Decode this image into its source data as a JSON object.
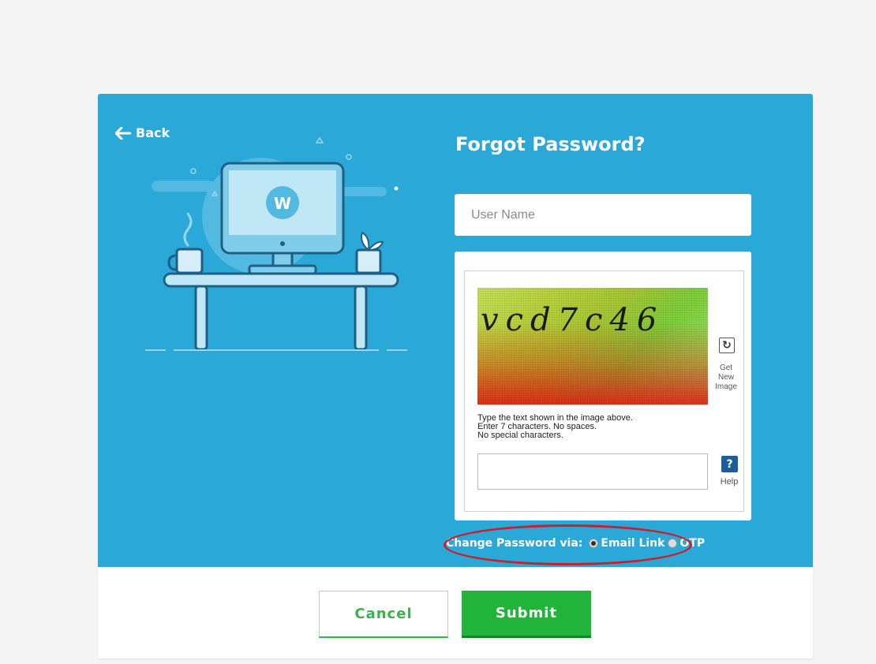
{
  "nav": {
    "back_label": "Back"
  },
  "form": {
    "title": "Forgot Password?",
    "username_placeholder": "User Name",
    "username_value": ""
  },
  "captcha": {
    "image_text": "vcd7c46",
    "new_image_label": "Get\nNew\nImage",
    "hint_lines": [
      "Type the text shown in the image above.",
      "Enter 7 characters. No spaces.",
      "No special characters."
    ],
    "input_value": "",
    "help_label": "Help"
  },
  "delivery": {
    "label": "Change Password via:",
    "options": [
      {
        "label": "Email Link",
        "checked": true
      },
      {
        "label": "OTP",
        "checked": false
      }
    ]
  },
  "actions": {
    "cancel_label": "Cancel",
    "submit_label": "Submit"
  },
  "colors": {
    "panel_blue": "#2aa8d8",
    "submit_green": "#21b33a",
    "highlight_red": "#cc1f2c"
  },
  "icons": {
    "back": "arrow-left-icon",
    "refresh": "refresh-icon",
    "help": "question-icon"
  }
}
